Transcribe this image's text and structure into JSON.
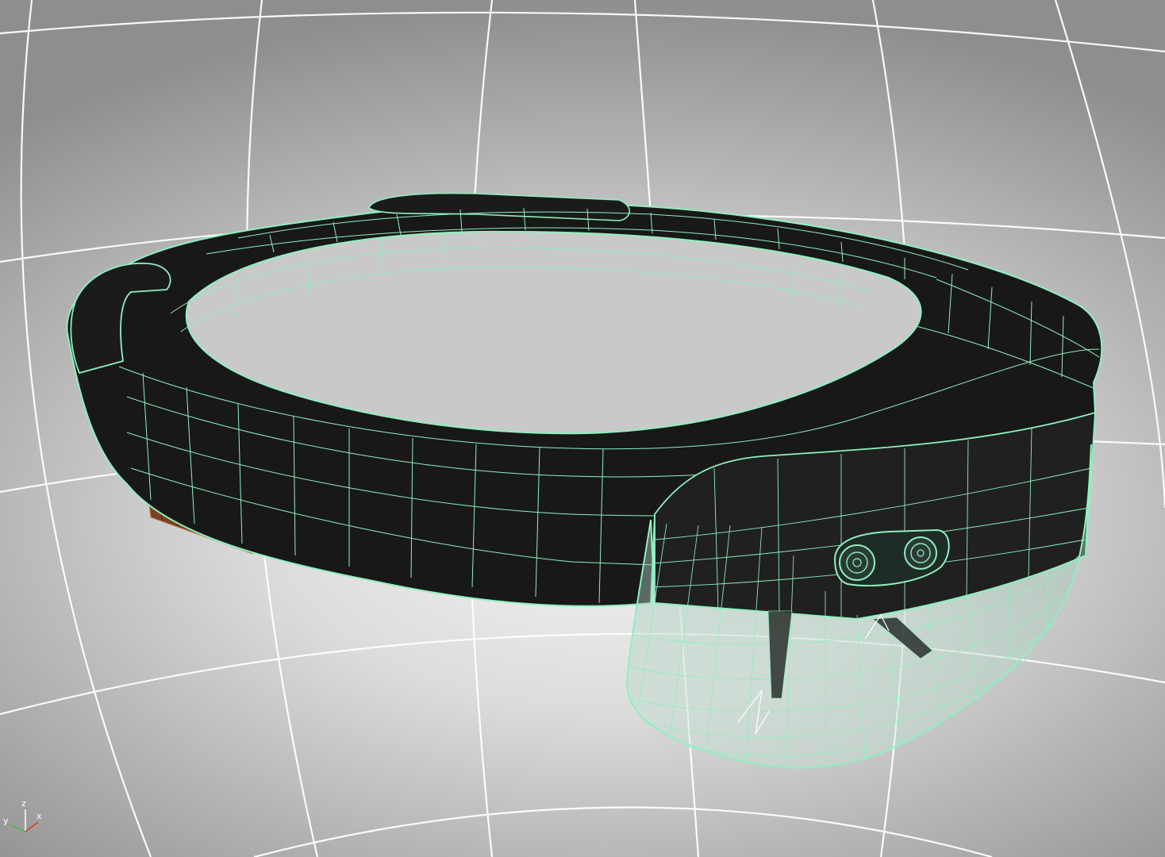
{
  "viewport": {
    "gizmo_axes": {
      "x": "x",
      "y": "y",
      "z": "z"
    },
    "pivot_axes": {
      "x": "x",
      "y": "y",
      "z": "z"
    }
  },
  "colors": {
    "wireframe": "#8ef0c0",
    "mesh_body": "#181818",
    "visor_tint": "#a9c9bb",
    "grid": "#ffffff",
    "pivot_axis": "#d83a2c",
    "pivot_z": "#9a9a9a",
    "pad_brown": "#7a4222"
  },
  "icons": {
    "model": "mixed-reality-headset-wireframe-icon",
    "gizmo": "view-axis-gizmo-icon"
  }
}
